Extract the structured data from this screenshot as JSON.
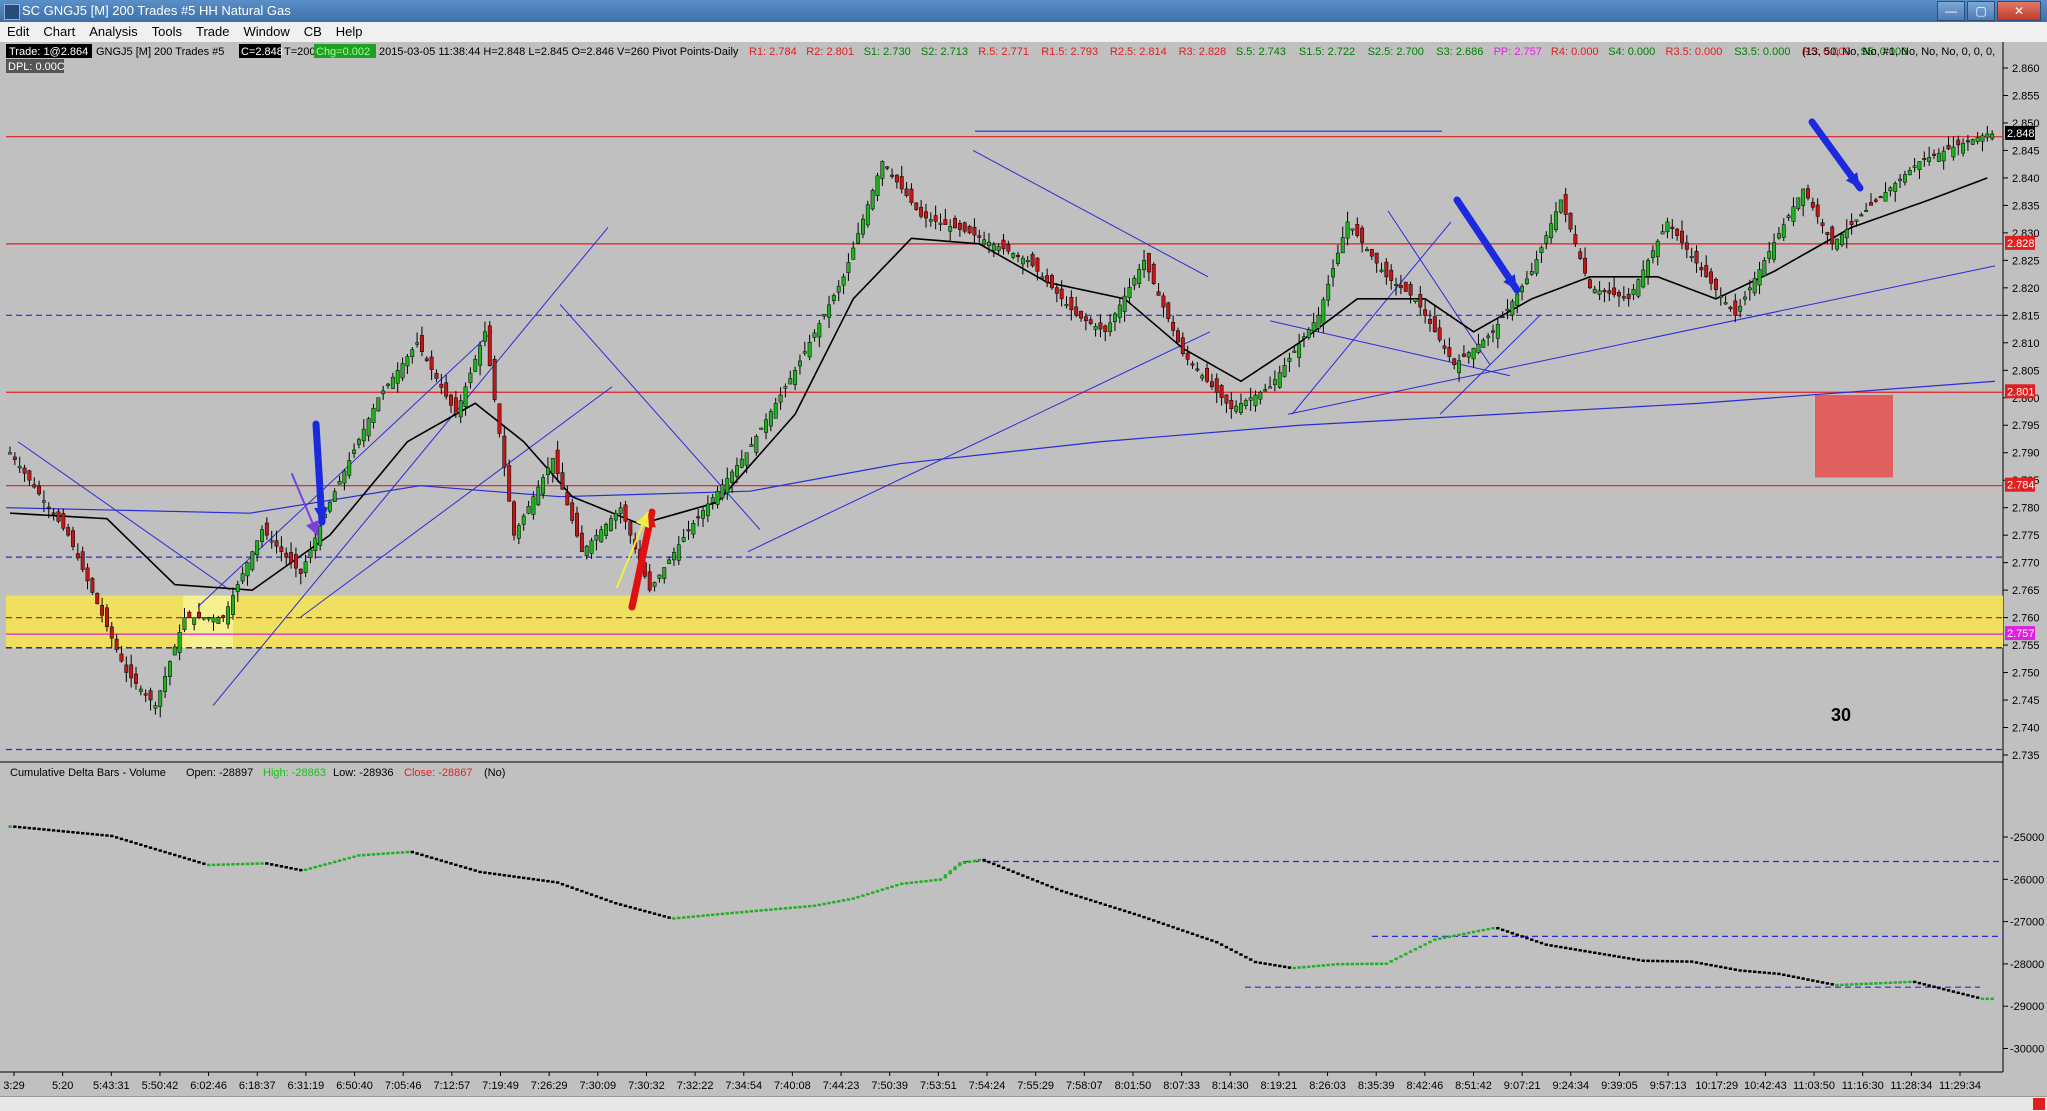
{
  "window": {
    "title": "SC GNGJ5 [M]  200 Trades  #5  HH Natural Gas",
    "buttons": [
      "—",
      "▢",
      "✕"
    ]
  },
  "menu": [
    "Edit",
    "Chart",
    "Analysis",
    "Tools",
    "Trade",
    "Window",
    "CB",
    "Help"
  ],
  "colors": {
    "background": "#c0c0c0",
    "up_bar": "#22b022",
    "down_bar": "#c01818",
    "moving_average": "#000000",
    "trend_lines": "#2b2bd6",
    "pivot_resistance": "#e02020",
    "pivot_support": "#008000",
    "zone": "#f0e060",
    "red_box": "#e06060",
    "arrow_blue": "#1a2adc",
    "arrow_red": "#e01010"
  },
  "header": {
    "trade_box": "Trade: 1@2.864",
    "symbol": "GNGJ5 [M]  200 Trades  #5",
    "close_box": "C=2.848",
    "trades_box": "T=200",
    "change_box": "Chg=0.002",
    "datetime_info": "2015-03-05 11:38:44 H=2.848 L=2.845 O=2.846 V=260 Pivot Points-Daily",
    "pivots": [
      {
        "text": "R1: 2.784",
        "kind": "r"
      },
      {
        "text": "R2: 2.801",
        "kind": "r"
      },
      {
        "text": "S1: 2.730",
        "kind": "s"
      },
      {
        "text": "S2: 2.713",
        "kind": "s"
      },
      {
        "text": "R.5: 2.771",
        "kind": "r"
      },
      {
        "text": "R1.5: 2.793",
        "kind": "r"
      },
      {
        "text": "R2.5: 2.814",
        "kind": "r"
      },
      {
        "text": "R3: 2.828",
        "kind": "r"
      },
      {
        "text": "S.5: 2.743",
        "kind": "s"
      },
      {
        "text": "S1.5: 2.722",
        "kind": "s"
      },
      {
        "text": "S2.5: 2.700",
        "kind": "s"
      },
      {
        "text": "S3: 2.686",
        "kind": "s"
      },
      {
        "text": "PP: 2.757",
        "kind": "p"
      },
      {
        "text": "R4: 0.000",
        "kind": "r"
      },
      {
        "text": "S4: 0.000",
        "kind": "s"
      },
      {
        "text": "R3.5: 0.000",
        "kind": "r"
      },
      {
        "text": "S3.5: 0.000",
        "kind": "s"
      },
      {
        "text": "R5: 0.000",
        "kind": "r"
      },
      {
        "text": "S5: 0.000",
        "kind": "s"
      }
    ],
    "params": "(13, 50, No, No, #1, No, No, No, 0, 0, 0,",
    "dpl": "DPL: 0.00C"
  },
  "subgraph": {
    "title": "Cumulative Delta Bars - Volume",
    "open": "Open: -28897",
    "high": "High: -28863",
    "low": "Low: -28936",
    "close": "Close: -28867",
    "no": "(No)"
  },
  "chart_data": [
    {
      "type": "candlestick",
      "title": "SC GNGJ5 [M]  200 Trades  #5  HH Natural Gas",
      "ylim": [
        2.731,
        2.862
      ],
      "y_ticks": [
        "2.860",
        "2.855",
        "2.850",
        "2.845",
        "2.840",
        "2.835",
        "2.830",
        "2.825",
        "2.820",
        "2.815",
        "2.810",
        "2.805",
        "2.800",
        "2.795",
        "2.790",
        "2.785",
        "2.780",
        "2.775",
        "2.770",
        "2.765",
        "2.760",
        "2.755",
        "2.750",
        "2.745",
        "2.740",
        "2.735"
      ],
      "x_tick_labels": [
        "3:29",
        "5:20",
        "5:43:31",
        "5:50:42",
        "6:02:46",
        "6:18:37",
        "6:31:19",
        "6:50:40",
        "7:05:46",
        "7:12:57",
        "7:19:49",
        "7:26:29",
        "7:30:09",
        "7:30:32",
        "7:32:22",
        "7:34:54",
        "7:40:08",
        "7:44:23",
        "7:50:39",
        "7:53:51",
        "7:54:24",
        "7:55:29",
        "7:58:07",
        "8:01:50",
        "8:07:33",
        "8:14:30",
        "8:19:21",
        "8:26:03",
        "8:35:39",
        "8:42:46",
        "8:51:42",
        "9:07:21",
        "9:24:34",
        "9:39:05",
        "9:57:13",
        "10:17:29",
        "10:42:43",
        "11:03:50",
        "11:16:30",
        "11:28:34",
        "11:29:34"
      ],
      "price_path": [
        [
          0,
          2.79
        ],
        [
          12,
          2.775
        ],
        [
          24,
          2.75
        ],
        [
          30,
          2.744
        ],
        [
          36,
          2.76
        ],
        [
          44,
          2.76
        ],
        [
          52,
          2.776
        ],
        [
          60,
          2.768
        ],
        [
          66,
          2.781
        ],
        [
          76,
          2.8
        ],
        [
          84,
          2.81
        ],
        [
          92,
          2.797
        ],
        [
          98,
          2.812
        ],
        [
          104,
          2.775
        ],
        [
          112,
          2.789
        ],
        [
          118,
          2.772
        ],
        [
          126,
          2.78
        ],
        [
          132,
          2.765
        ],
        [
          140,
          2.776
        ],
        [
          152,
          2.79
        ],
        [
          162,
          2.805
        ],
        [
          172,
          2.822
        ],
        [
          180,
          2.843
        ],
        [
          188,
          2.833
        ],
        [
          198,
          2.83
        ],
        [
          210,
          2.825
        ],
        [
          220,
          2.815
        ],
        [
          226,
          2.812
        ],
        [
          234,
          2.825
        ],
        [
          242,
          2.808
        ],
        [
          252,
          2.798
        ],
        [
          260,
          2.802
        ],
        [
          270,
          2.815
        ],
        [
          276,
          2.832
        ],
        [
          284,
          2.822
        ],
        [
          290,
          2.818
        ],
        [
          298,
          2.806
        ],
        [
          306,
          2.812
        ],
        [
          314,
          2.823
        ],
        [
          320,
          2.836
        ],
        [
          326,
          2.82
        ],
        [
          334,
          2.818
        ],
        [
          342,
          2.832
        ],
        [
          350,
          2.822
        ],
        [
          356,
          2.815
        ],
        [
          362,
          2.825
        ],
        [
          370,
          2.838
        ],
        [
          376,
          2.828
        ],
        [
          384,
          2.835
        ],
        [
          394,
          2.843
        ],
        [
          402,
          2.846
        ],
        [
          408,
          2.848
        ]
      ],
      "moving_average_path": [
        [
          0,
          2.779
        ],
        [
          20,
          2.778
        ],
        [
          34,
          2.766
        ],
        [
          50,
          2.765
        ],
        [
          66,
          2.775
        ],
        [
          82,
          2.792
        ],
        [
          96,
          2.799
        ],
        [
          106,
          2.792
        ],
        [
          116,
          2.782
        ],
        [
          130,
          2.777
        ],
        [
          146,
          2.781
        ],
        [
          162,
          2.797
        ],
        [
          174,
          2.818
        ],
        [
          186,
          2.829
        ],
        [
          200,
          2.828
        ],
        [
          214,
          2.821
        ],
        [
          230,
          2.818
        ],
        [
          242,
          2.809
        ],
        [
          254,
          2.803
        ],
        [
          266,
          2.81
        ],
        [
          278,
          2.818
        ],
        [
          292,
          2.818
        ],
        [
          302,
          2.812
        ],
        [
          314,
          2.818
        ],
        [
          326,
          2.822
        ],
        [
          340,
          2.822
        ],
        [
          352,
          2.818
        ],
        [
          364,
          2.823
        ],
        [
          380,
          2.831
        ],
        [
          396,
          2.836
        ],
        [
          408,
          2.84
        ]
      ],
      "price_label": "2.848",
      "level_labels": [
        "2.828",
        "2.801",
        "2.784",
        "2.757"
      ],
      "annotation": "30"
    },
    {
      "type": "bar",
      "title": "Cumulative Delta Bars - Volume",
      "ylim": [
        -30300,
        -24300
      ],
      "y_ticks": [
        "-25000",
        "-26000",
        "-27000",
        "-28000",
        "-29000",
        "-30000"
      ],
      "delta_path": [
        [
          0,
          -24750
        ],
        [
          20,
          -24970
        ],
        [
          40,
          -25660
        ],
        [
          52,
          -25620
        ],
        [
          60,
          -25800
        ],
        [
          72,
          -25430
        ],
        [
          82,
          -25350
        ],
        [
          96,
          -25820
        ],
        [
          112,
          -26070
        ],
        [
          124,
          -26560
        ],
        [
          136,
          -26930
        ],
        [
          150,
          -26780
        ],
        [
          166,
          -26620
        ],
        [
          174,
          -26450
        ],
        [
          184,
          -26100
        ],
        [
          192,
          -26000
        ],
        [
          196,
          -25620
        ],
        [
          200,
          -25540
        ],
        [
          216,
          -26270
        ],
        [
          232,
          -26850
        ],
        [
          248,
          -27480
        ],
        [
          256,
          -27950
        ],
        [
          264,
          -28100
        ],
        [
          274,
          -28000
        ],
        [
          284,
          -27990
        ],
        [
          294,
          -27420
        ],
        [
          306,
          -27150
        ],
        [
          316,
          -27540
        ],
        [
          336,
          -27920
        ],
        [
          346,
          -27940
        ],
        [
          356,
          -28150
        ],
        [
          364,
          -28230
        ],
        [
          376,
          -28500
        ],
        [
          392,
          -28420
        ],
        [
          406,
          -28820
        ]
      ]
    }
  ]
}
